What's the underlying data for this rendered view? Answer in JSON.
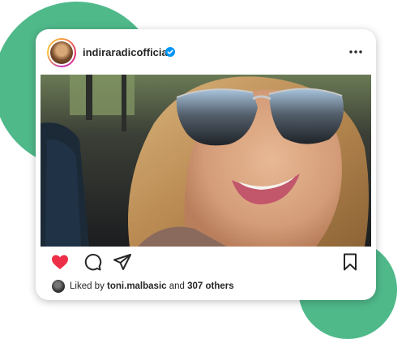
{
  "post": {
    "username": "indiraradicofficial",
    "verified_icon": "verified-badge-icon",
    "more_icon": "more-dots-icon",
    "photo_description_icon": "selfie-photo",
    "liked_by_prefix": "Liked by",
    "liked_by_user": "toni.malbasic",
    "liked_by_and": "and",
    "liked_by_others": "307 others"
  },
  "actions": {
    "like_icon": "heart-icon",
    "comment_icon": "comment-icon",
    "share_icon": "share-icon",
    "save_icon": "bookmark-icon"
  },
  "colors": {
    "accent_green": "#4fb98a",
    "like_red": "#ed2f48",
    "verified_blue": "#0095f6"
  }
}
